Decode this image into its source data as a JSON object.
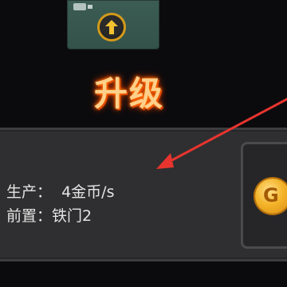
{
  "title": "升级",
  "stats": {
    "produce": "生产：  4金币/s",
    "prereq": "前置：铁门2"
  },
  "icons": {
    "top_tile": "upgrade-arrow-icon",
    "button": "gold-coin-icon",
    "annotation": "red-arrow-icon"
  },
  "colors": {
    "title": "#ffd08a",
    "title_glow": "#ff5a00",
    "annotation_arrow": "#e8342e",
    "coin": "#f4b429",
    "panel": "#2f2f31"
  }
}
